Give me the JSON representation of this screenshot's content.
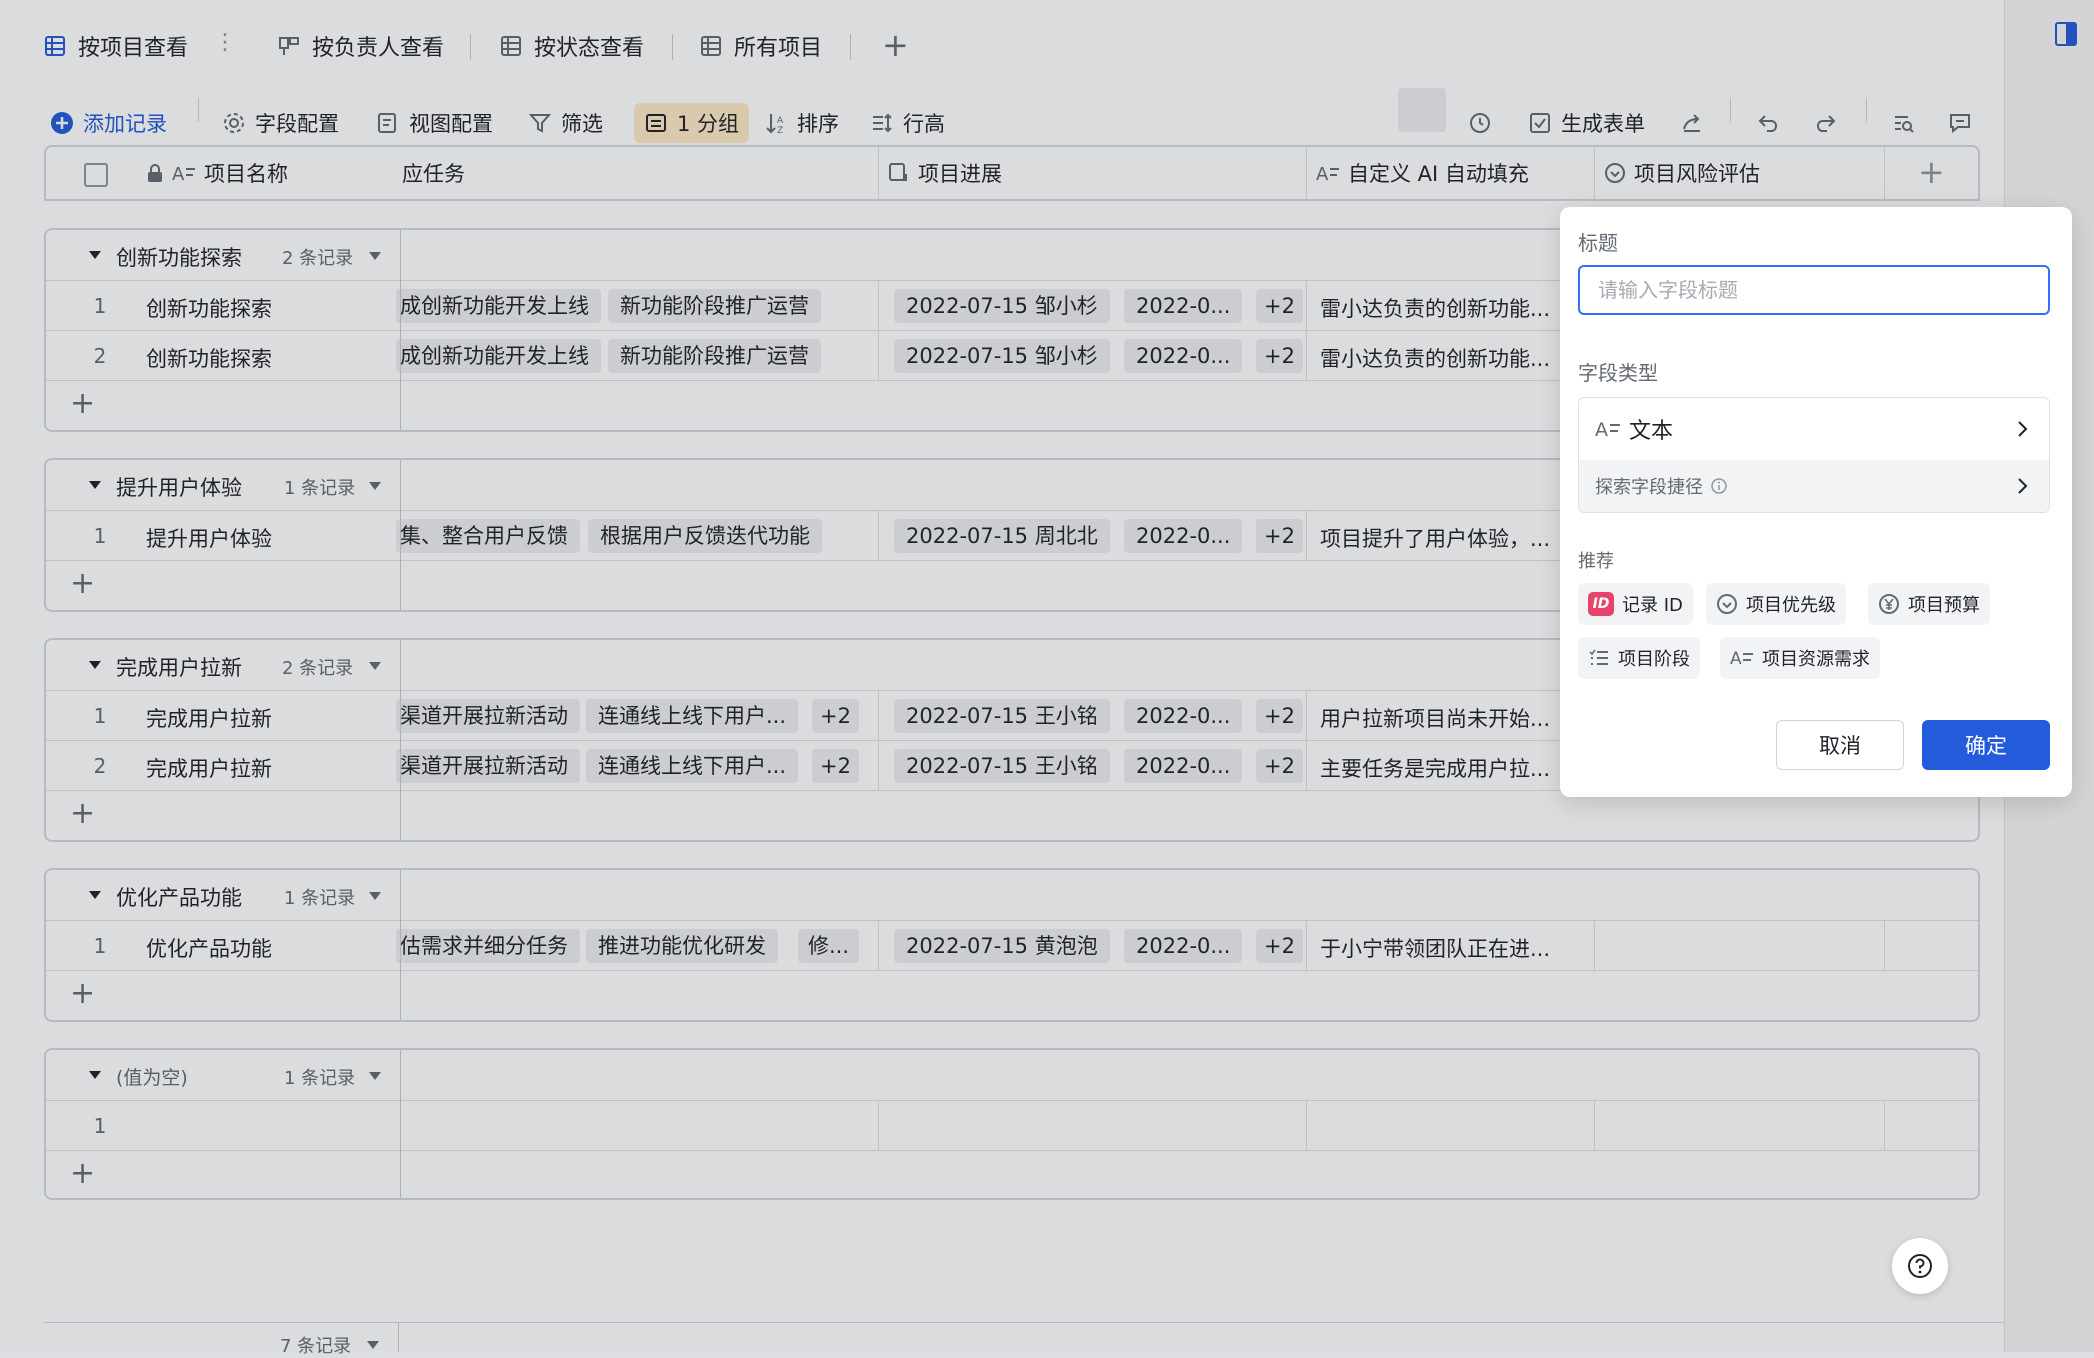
{
  "tabs": [
    {
      "label": "按项目查看",
      "icon": "grid-icon",
      "active": true
    },
    {
      "label": "按负责人查看",
      "icon": "kanban-icon",
      "active": false
    },
    {
      "label": "按状态查看",
      "icon": "grid-icon",
      "active": false
    },
    {
      "label": "所有项目",
      "icon": "grid-icon",
      "active": false
    }
  ],
  "tab_more": "⋮",
  "tab_add": "+",
  "toolbar": {
    "add_record": "添加记录",
    "field_config": "字段配置",
    "view_config": "视图配置",
    "filter": "筛选",
    "group": "1 分组",
    "sort": "排序",
    "row_height": "行高",
    "gen_form": "生成表单"
  },
  "columns": {
    "name": "项目名称",
    "task": "应任务",
    "progress": "项目进展",
    "ai_fill": "自定义 AI 自动填充",
    "risk": "项目风险评估",
    "add": "+"
  },
  "groups": [
    {
      "name": "创新功能探索",
      "count": "2 条记录",
      "rows": [
        {
          "num": "1",
          "name": "创新功能探索",
          "tasks": [
            "成创新功能开发上线",
            "新功能阶段推广运营"
          ],
          "tasks_more": "",
          "progress_date": "2022-07-15 邹小杉",
          "progress_date2": "2022-0...",
          "progress_more": "+2",
          "ai": "雷小达负责的创新功能..."
        },
        {
          "num": "2",
          "name": "创新功能探索",
          "tasks": [
            "成创新功能开发上线",
            "新功能阶段推广运营"
          ],
          "tasks_more": "",
          "progress_date": "2022-07-15 邹小杉",
          "progress_date2": "2022-0...",
          "progress_more": "+2",
          "ai": "雷小达负责的创新功能..."
        }
      ]
    },
    {
      "name": "提升用户体验",
      "count": "1 条记录",
      "rows": [
        {
          "num": "1",
          "name": "提升用户体验",
          "tasks": [
            "集、整合用户反馈",
            "根据用户反馈迭代功能"
          ],
          "tasks_more": "",
          "progress_date": "2022-07-15 周北北",
          "progress_date2": "2022-0...",
          "progress_more": "+2",
          "ai": "项目提升了用户体验，..."
        }
      ]
    },
    {
      "name": "完成用户拉新",
      "count": "2 条记录",
      "rows": [
        {
          "num": "1",
          "name": "完成用户拉新",
          "tasks": [
            "渠道开展拉新活动",
            "连通线上线下用户..."
          ],
          "tasks_more": "+2",
          "progress_date": "2022-07-15 王小铭",
          "progress_date2": "2022-0...",
          "progress_more": "+2",
          "ai": "用户拉新项目尚未开始..."
        },
        {
          "num": "2",
          "name": "完成用户拉新",
          "tasks": [
            "渠道开展拉新活动",
            "连通线上线下用户..."
          ],
          "tasks_more": "+2",
          "progress_date": "2022-07-15 王小铭",
          "progress_date2": "2022-0...",
          "progress_more": "+2",
          "ai": "主要任务是完成用户拉..."
        }
      ]
    },
    {
      "name": "优化产品功能",
      "count": "1 条记录",
      "rows": [
        {
          "num": "1",
          "name": "优化产品功能",
          "tasks": [
            "估需求并细分任务",
            "推进功能优化研发",
            "修..."
          ],
          "tasks_more": "",
          "progress_date": "2022-07-15 黄泡泡",
          "progress_date2": "2022-0...",
          "progress_more": "+2",
          "ai": "于小宁带领团队正在进..."
        }
      ]
    },
    {
      "name": "(值为空)",
      "count": "1 条记录",
      "rows": [
        {
          "num": "1",
          "name": "",
          "tasks": [],
          "tasks_more": "",
          "progress_date": "",
          "progress_date2": "",
          "progress_more": "",
          "ai": ""
        }
      ]
    }
  ],
  "footer_count": "7 条记录",
  "panel": {
    "title_label": "标题",
    "title_placeholder": "请输入字段标题",
    "type_label": "字段类型",
    "type_value": "文本",
    "explore": "探索字段捷径",
    "recommend_label": "推荐",
    "recommend": [
      {
        "label": "记录 ID",
        "icon": "id-icon"
      },
      {
        "label": "项目优先级",
        "icon": "select-icon"
      },
      {
        "label": "项目预算",
        "icon": "currency-icon"
      },
      {
        "label": "项目阶段",
        "icon": "list-icon"
      },
      {
        "label": "项目资源需求",
        "icon": "text-icon"
      }
    ],
    "cancel": "取消",
    "ok": "确定"
  },
  "colors": {
    "accent": "#245bdb",
    "group_highlight": "#fde9c6",
    "input_border": "#3370ff",
    "id_badge": "#e8436d"
  }
}
